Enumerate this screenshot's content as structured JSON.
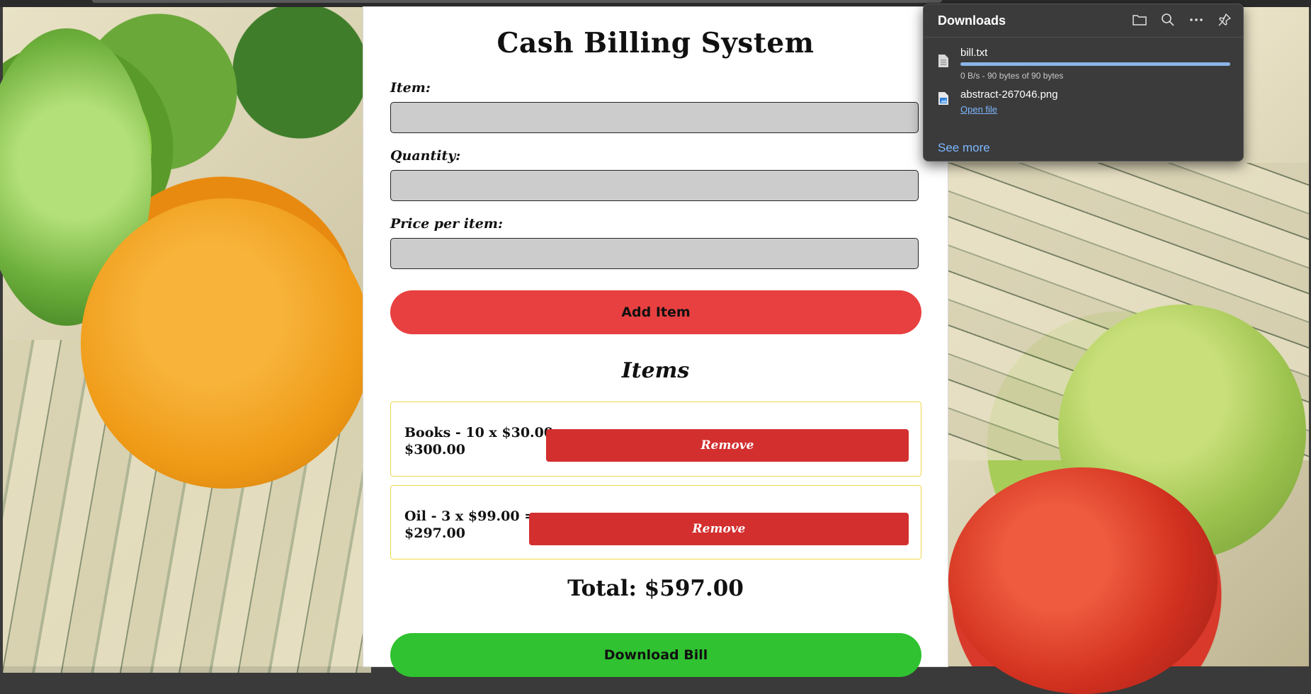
{
  "app": {
    "title": "Cash Billing System"
  },
  "form": {
    "item_label": "Item:",
    "item_value": "",
    "quantity_label": "Quantity:",
    "quantity_value": "",
    "price_label": "Price per item:",
    "price_value": "",
    "add_button": "Add Item"
  },
  "items_section": {
    "heading": "Items",
    "items": [
      {
        "line1": "Books - 10 x $30.00 =",
        "line2": "$300.00",
        "remove_label": "Remove"
      },
      {
        "line1": "Oil - 3 x $99.00 =",
        "line2": "$297.00",
        "remove_label": "Remove"
      }
    ]
  },
  "total": "Total: $597.00",
  "download_button": "Download Bill",
  "downloads": {
    "title": "Downloads",
    "icons": [
      "folder-icon",
      "search-icon",
      "more-icon",
      "pin-icon"
    ],
    "files": [
      {
        "name": "bill.txt",
        "status": "0 B/s - 90 bytes of 90 bytes",
        "progress": 1.0
      },
      {
        "name": "abstract-267046.png",
        "action": "Open file"
      }
    ],
    "see_more": "See more"
  },
  "colors": {
    "add_button": "#e84040",
    "remove_button": "#d32f2f",
    "download_button": "#30c230",
    "item_border": "#f0d84a",
    "input_bg": "#cccccc",
    "downloads_bg": "#3b3b3b",
    "link": "#7db7ff"
  }
}
